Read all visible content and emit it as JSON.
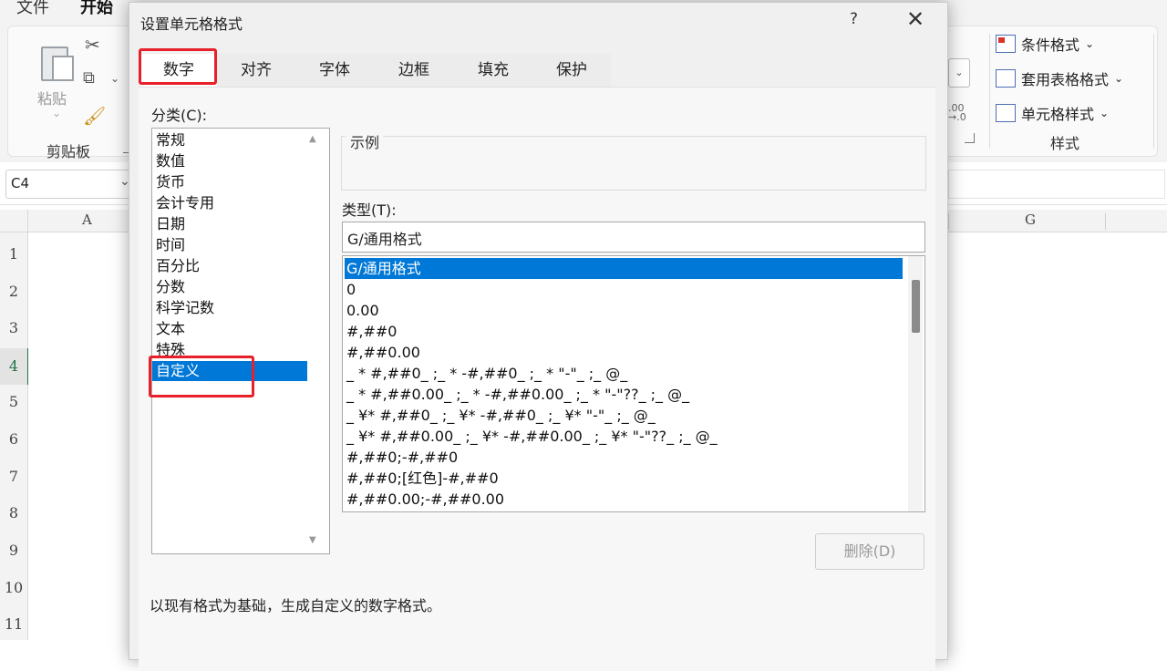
{
  "menubar": {
    "file": "文件",
    "home": "开始"
  },
  "ribbon": {
    "clipboard": {
      "paste": "粘贴",
      "group_label": "剪贴板"
    },
    "styles": {
      "conditional": "条件格式",
      "table_format": "套用表格格式",
      "cell_style": "单元格样式",
      "group_label": "样式"
    }
  },
  "formula_bar": {
    "name_box": "C4"
  },
  "columns": [
    "A",
    "G"
  ],
  "rows": [
    "1",
    "2",
    "3",
    "4",
    "5",
    "6",
    "7",
    "8",
    "9",
    "10",
    "11"
  ],
  "active_row": "4",
  "dialog": {
    "title": "设置单元格格式",
    "help": "?",
    "close": "✕",
    "tabs": [
      "数字",
      "对齐",
      "字体",
      "边框",
      "填充",
      "保护"
    ],
    "selected_tab": "数字",
    "category_label": "分类(C):",
    "categories": [
      "常规",
      "数值",
      "货币",
      "会计专用",
      "日期",
      "时间",
      "百分比",
      "分数",
      "科学记数",
      "文本",
      "特殊",
      "自定义"
    ],
    "selected_category": "自定义",
    "sample_label": "示例",
    "type_label": "类型(T):",
    "type_value": "G/通用格式",
    "formats": [
      "G/通用格式",
      "0",
      "0.00",
      "#,##0",
      "#,##0.00",
      "_ * #,##0_ ;_ * -#,##0_ ;_ * \"-\"_ ;_ @_",
      "_ * #,##0.00_ ;_ * -#,##0.00_ ;_ * \"-\"??_ ;_ @_",
      "_ ¥* #,##0_ ;_ ¥* -#,##0_ ;_ ¥* \"-\"_ ;_ @_",
      "_ ¥* #,##0.00_ ;_ ¥* -#,##0.00_ ;_ ¥* \"-\"??_ ;_ @_",
      "#,##0;-#,##0",
      "#,##0;[红色]-#,##0",
      "#,##0.00;-#,##0.00"
    ],
    "delete_button": "删除(D)",
    "description": "以现有格式为基础，生成自定义的数字格式。"
  },
  "colors": {
    "highlight": "#e8202a",
    "selection": "#0078d7"
  }
}
